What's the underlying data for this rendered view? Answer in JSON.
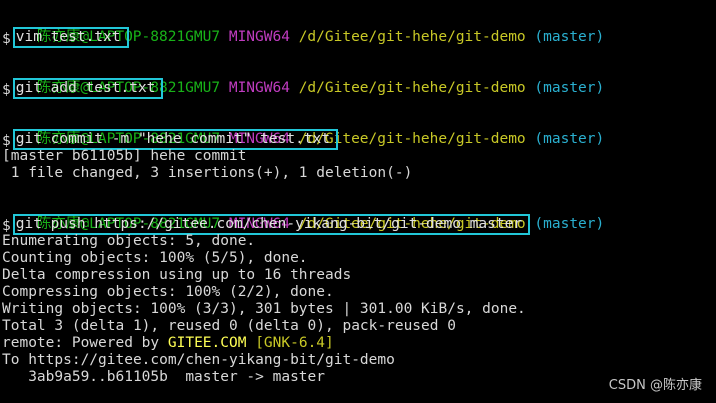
{
  "prompt": {
    "user_host": "陈亦康@LAPTOP-8821GMU7",
    "shell": "MINGW64",
    "path": "/d/Gitee/git-hehe/git-demo",
    "branch": "(master)",
    "dollar": "$"
  },
  "commands": [
    "vim test.txt",
    "git add test.txt",
    "git commit -m \"hehe commit\" test.txt",
    "git push https://gitee.com/chen-yikang-bit/git-demo master"
  ],
  "commit_output": [
    "[master b61105b] hehe commit",
    " 1 file changed, 3 insertions(+), 1 deletion(-)"
  ],
  "push_output": {
    "lines_before_remote": [
      "Enumerating objects: 5, done.",
      "Counting objects: 100% (5/5), done.",
      "Delta compression using up to 16 threads",
      "Compressing objects: 100% (2/2), done.",
      "Writing objects: 100% (3/3), 301 bytes | 301.00 KiB/s, done.",
      "Total 3 (delta 1), reused 0 (delta 0), pack-reused 0"
    ],
    "remote_prefix": "remote: Powered by ",
    "remote_brand": "GITEE.COM",
    "remote_space": " ",
    "remote_version": "[GNK-6.4]",
    "lines_after_remote": [
      "To https://gitee.com/chen-yikang-bit/git-demo",
      "   3ab9a59..b61105b  master -> master"
    ]
  },
  "watermark": "CSDN @陈亦康",
  "colors": {
    "background": "#000000",
    "user_host": "#18b218",
    "shell": "#c03cc0",
    "path": "#c8c826",
    "branch": "#2ab0d0",
    "highlight_box": "#22c7d8"
  }
}
